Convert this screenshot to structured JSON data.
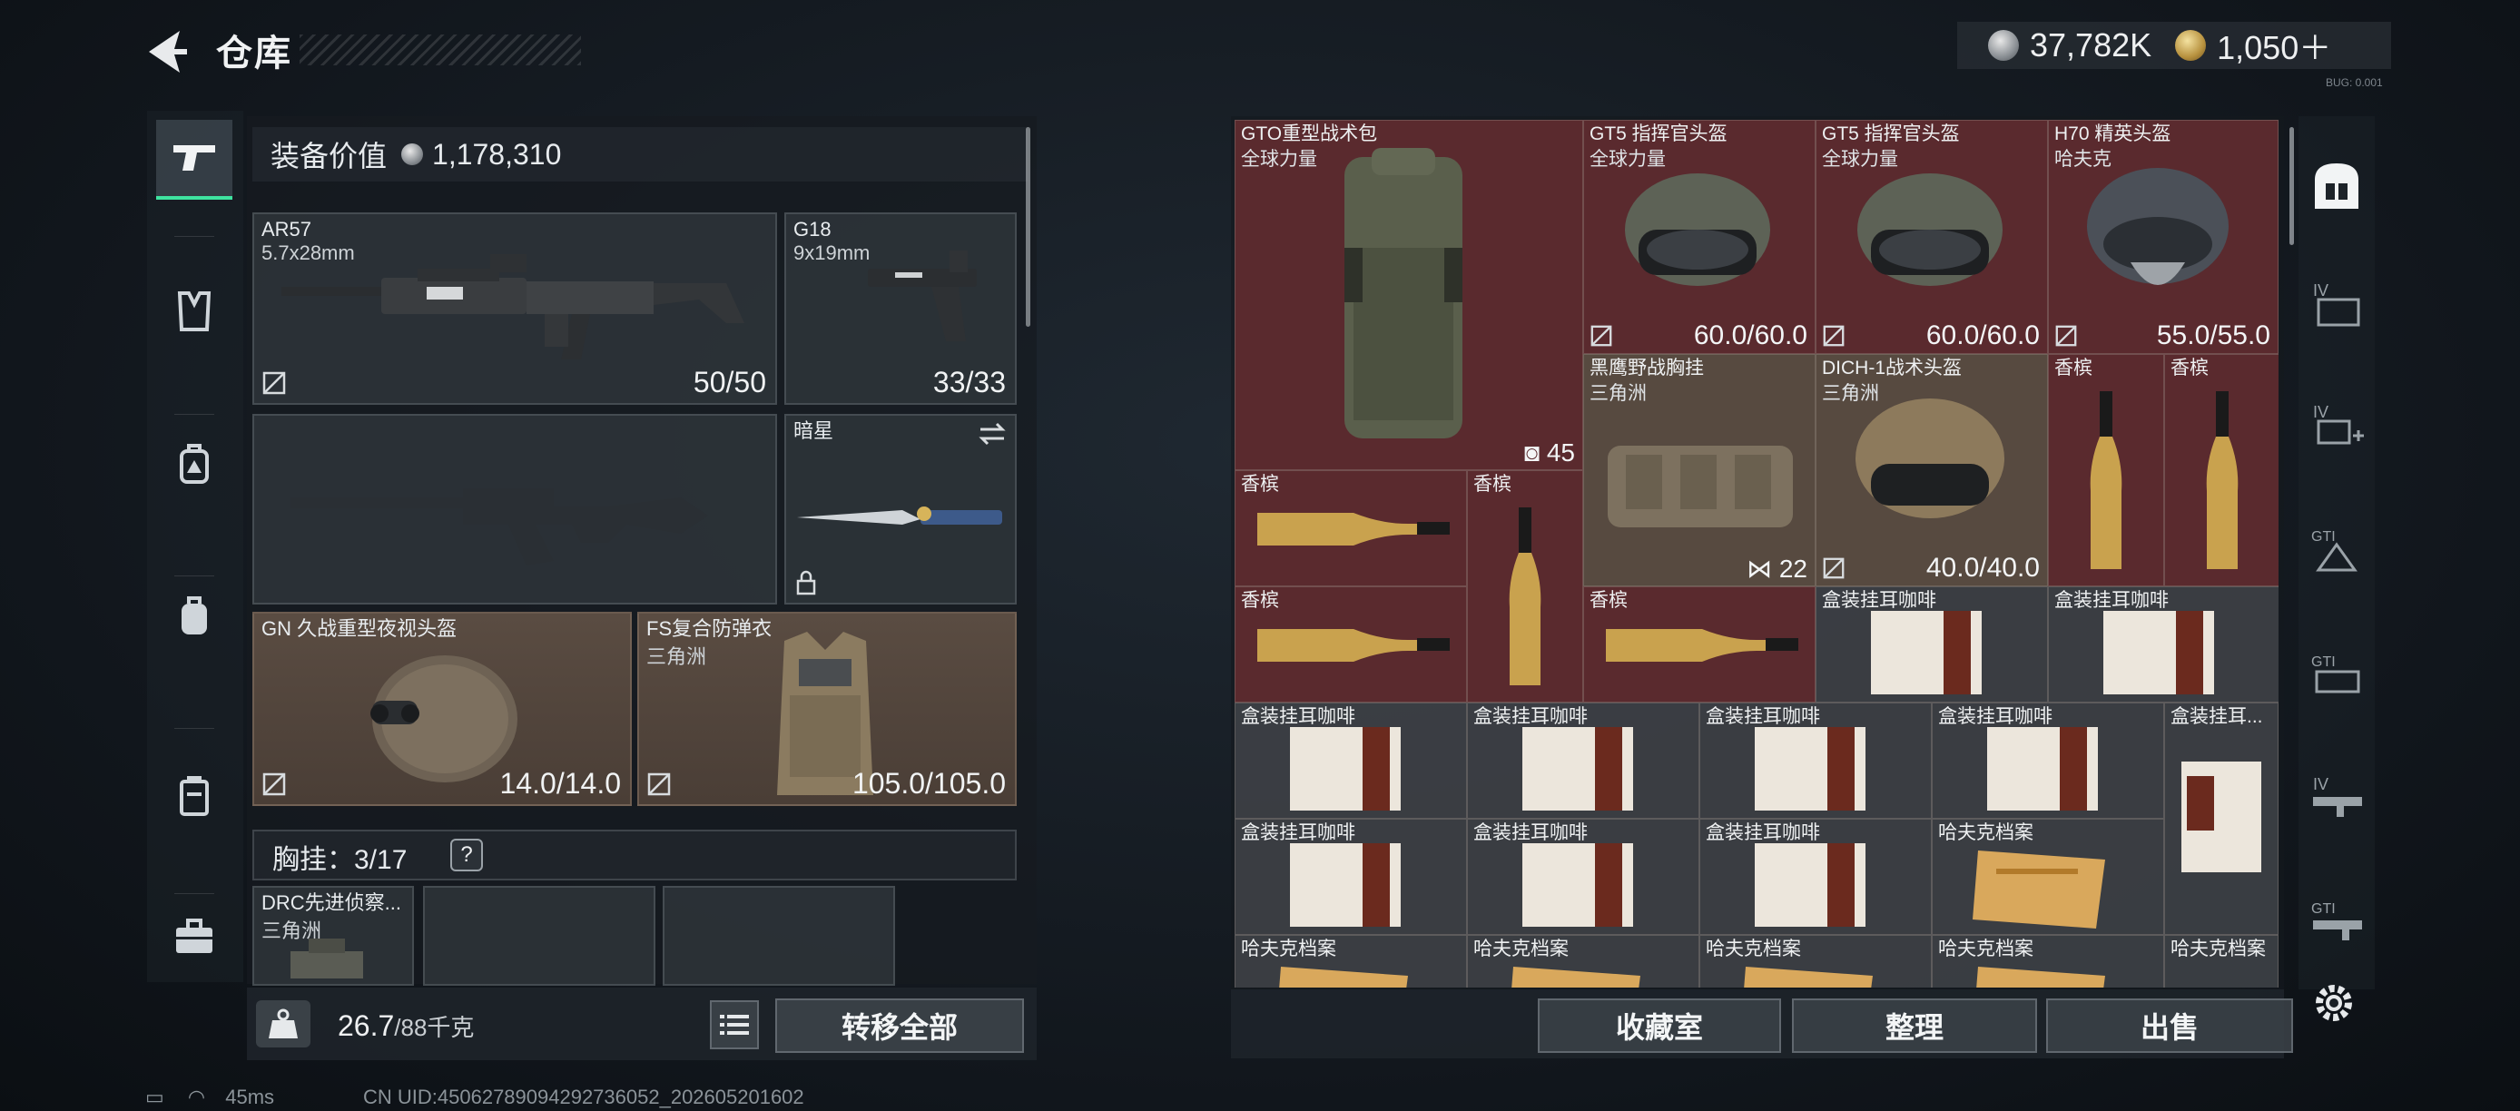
{
  "header": {
    "title": "仓库",
    "back_icon": "back-arrow-icon"
  },
  "currency": {
    "silver": "37,782K",
    "gold": "1,050＋",
    "version": "BUG: 0.001"
  },
  "equip_value": {
    "label": "装备价值",
    "value": "1,178,310"
  },
  "left_nav": [
    "pistol-icon",
    "armor-vest-icon",
    "backpack-chest-icon",
    "backpack-icon",
    "case-icon",
    "toolbox-icon"
  ],
  "weapon_slots": [
    {
      "name": "AR57",
      "caliber": "5.7x28mm",
      "ammo": "50/50"
    },
    {
      "name": "G18",
      "caliber": "9x19mm",
      "ammo": "33/33"
    },
    {
      "name": "",
      "caliber": "",
      "ammo": ""
    },
    {
      "name": "暗星",
      "caliber": "",
      "ammo": ""
    }
  ],
  "gear_slots": [
    {
      "name": "GN 久战重型夜视头盔",
      "sub": "",
      "durability": "14.0/14.0"
    },
    {
      "name": "FS复合防弹衣",
      "sub": "三角洲",
      "durability": "105.0/105.0"
    }
  ],
  "chest_rig": {
    "label": "胸挂",
    "count": "3/17",
    "help": "?"
  },
  "chest_items": [
    {
      "name": "DRC先进侦察...",
      "sub": "三角洲"
    }
  ],
  "weight": {
    "value": "26.7",
    "max": "/88千克"
  },
  "transfer_all": "转移全部",
  "stash_items": [
    {
      "name": "GTO重型战术包",
      "sub": "全球力量",
      "count": "45",
      "count_icon": "backpack-small-icon"
    },
    {
      "name": "GT5 指挥官头盔",
      "sub": "全球力量",
      "durability": "60.0/60.0"
    },
    {
      "name": "GT5 指挥官头盔",
      "sub": "全球力量",
      "durability": "60.0/60.0"
    },
    {
      "name": "H70 精英头盔",
      "sub": "哈夫克",
      "durability": "55.0/55.0"
    },
    {
      "name": "黑鹰野战胸挂",
      "sub": "三角洲",
      "count": "22",
      "count_icon": "vest-small-icon"
    },
    {
      "name": "DICH-1战术头盔",
      "sub": "三角洲",
      "durability": "40.0/40.0"
    },
    {
      "name": "香槟"
    },
    {
      "name": "香槟"
    },
    {
      "name": "香槟"
    },
    {
      "name": "香槟"
    },
    {
      "name": "香槟"
    },
    {
      "name": "香槟"
    },
    {
      "name": "盒装挂耳咖啡"
    },
    {
      "name": "盒装挂耳咖啡"
    },
    {
      "name": "盒装挂耳咖啡"
    },
    {
      "name": "盒装挂耳咖啡"
    },
    {
      "name": "盒装挂耳咖啡"
    },
    {
      "name": "盒装挂耳咖啡"
    },
    {
      "name": "盒装挂耳..."
    },
    {
      "name": "盒装挂耳咖啡"
    },
    {
      "name": "盒装挂耳咖啡"
    },
    {
      "name": "盒装挂耳咖啡"
    },
    {
      "name": "哈夫克档案"
    },
    {
      "name": "哈夫克档案"
    },
    {
      "name": "哈夫克档案"
    },
    {
      "name": "哈夫克档案"
    },
    {
      "name": "哈夫克档案"
    },
    {
      "name": "哈夫克档案"
    }
  ],
  "stash_buttons": {
    "collection": "收藏室",
    "sort": "整理",
    "sell": "出售"
  },
  "right_nav": [
    "stash-home-icon",
    "tier-iv-case-icon",
    "tier-iv-add-icon",
    "gti-a-icon",
    "gti-case-icon",
    "tier-iv-gun-icon",
    "gti-gun-icon",
    "settings-gear-icon"
  ],
  "footer": {
    "ping": "45ms",
    "uid": "CN UID:4506278909429273605​2_202605201602"
  }
}
